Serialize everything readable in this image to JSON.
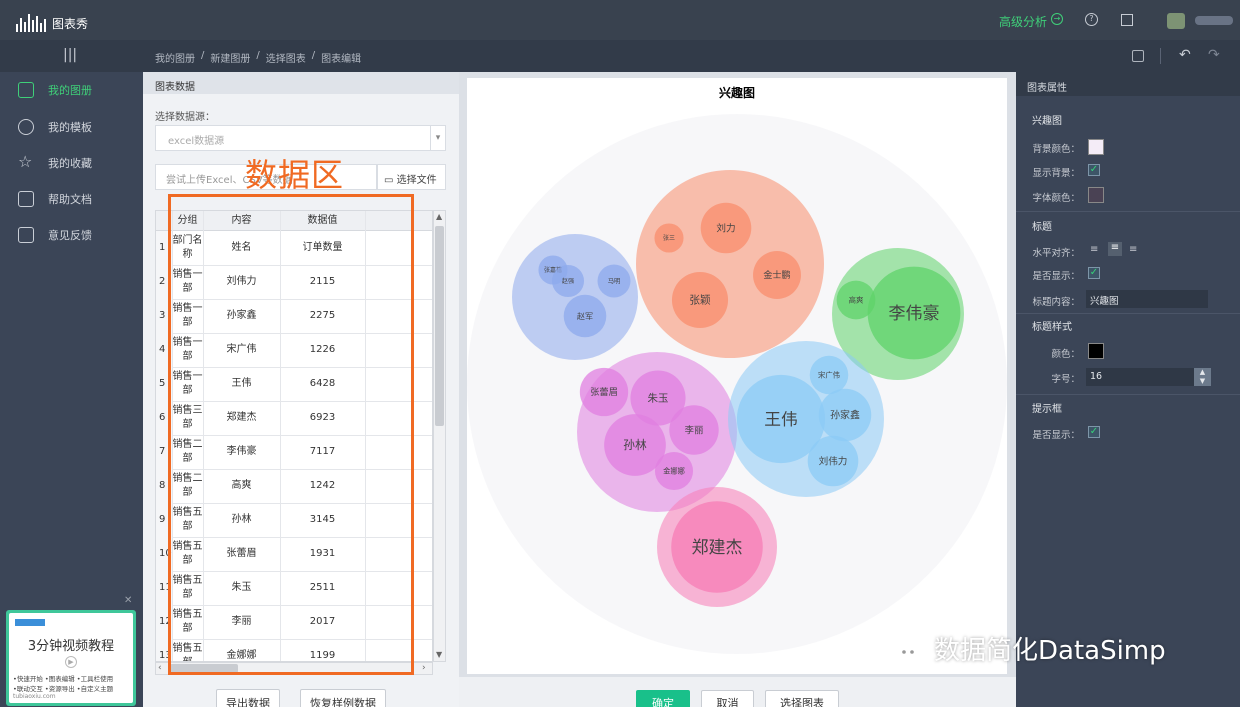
{
  "app": {
    "brand": "图表秀",
    "advanced": "高级分析"
  },
  "breadcrumb": [
    "我的图册",
    "/",
    "新建图册",
    "/",
    "选择图表",
    "/",
    "图表编辑"
  ],
  "sidebar": {
    "items": [
      {
        "label": "我的图册"
      },
      {
        "label": "我的模板"
      },
      {
        "label": "我的收藏"
      },
      {
        "label": "帮助文档"
      },
      {
        "label": "意见反馈"
      }
    ]
  },
  "promo": {
    "title": "3分钟视频教程",
    "lines": [
      "•快速开始 •图表编辑 •工具栏使用",
      "•联动交互 •资源导出 •自定义主题"
    ],
    "url": "tubiaoxiu.com"
  },
  "data_panel": {
    "title": "图表数据",
    "source_label": "选择数据源：",
    "source_value": "excel数据源",
    "upload_placeholder": "尝试上传Excel、CSV等数据",
    "upload_button": "选择文件",
    "export_button": "导出数据",
    "restore_button": "恢复样例数据",
    "annotation": "数据区"
  },
  "table": {
    "headers": [
      "分组",
      "内容",
      "数据值"
    ],
    "rows": [
      {
        "n": "1",
        "g": "部门名称",
        "c": "姓名",
        "v": "订单数量"
      },
      {
        "n": "2",
        "g": "销售一部",
        "c": "刘伟力",
        "v": "2115"
      },
      {
        "n": "3",
        "g": "销售一部",
        "c": "孙家鑫",
        "v": "2275"
      },
      {
        "n": "4",
        "g": "销售一部",
        "c": "宋广伟",
        "v": "1226"
      },
      {
        "n": "5",
        "g": "销售一部",
        "c": "王伟",
        "v": "6428"
      },
      {
        "n": "6",
        "g": "销售三部",
        "c": "郑建杰",
        "v": "6923"
      },
      {
        "n": "7",
        "g": "销售二部",
        "c": "李伟豪",
        "v": "7117"
      },
      {
        "n": "8",
        "g": "销售二部",
        "c": "高爽",
        "v": "1242"
      },
      {
        "n": "9",
        "g": "销售五部",
        "c": "孙林",
        "v": "3145"
      },
      {
        "n": "10",
        "g": "销售五部",
        "c": "张蕾眉",
        "v": "1931"
      },
      {
        "n": "11",
        "g": "销售五部",
        "c": "朱玉",
        "v": "2511"
      },
      {
        "n": "12",
        "g": "销售五部",
        "c": "李丽",
        "v": "2017"
      },
      {
        "n": "13",
        "g": "销售五部",
        "c": "金娜娜",
        "v": "1199"
      }
    ]
  },
  "chart_data": {
    "type": "bubble-pack",
    "title": "兴趣图",
    "groups": [
      {
        "color": "#8eaaec",
        "children": [
          {
            "name": "赵军",
            "value": 1500
          },
          {
            "name": "张嘉禧",
            "value": 700
          },
          {
            "name": "赵强",
            "value": 850
          },
          {
            "name": "马明",
            "value": 900
          }
        ]
      },
      {
        "color": "#f98e6c",
        "children": [
          {
            "name": "刘力",
            "value": 2115
          },
          {
            "name": "张三",
            "value": 700
          },
          {
            "name": "张颖",
            "value": 2600
          },
          {
            "name": "金士鹏",
            "value": 1900
          }
        ]
      },
      {
        "color": "#5fd36a",
        "children": [
          {
            "name": "李伟豪",
            "value": 7117
          },
          {
            "name": "高爽",
            "value": 1242
          }
        ]
      },
      {
        "color": "#e07fe0",
        "children": [
          {
            "name": "张蕾眉",
            "value": 1931
          },
          {
            "name": "朱玉",
            "value": 2511
          },
          {
            "name": "孙林",
            "value": 3145
          },
          {
            "name": "李丽",
            "value": 2017
          },
          {
            "name": "金娜娜",
            "value": 1199
          }
        ]
      },
      {
        "color": "#8ccbf6",
        "children": [
          {
            "name": "王伟",
            "value": 6428
          },
          {
            "name": "宋广伟",
            "value": 1226
          },
          {
            "name": "孙家鑫",
            "value": 2275
          },
          {
            "name": "刘伟力",
            "value": 2115
          }
        ]
      },
      {
        "color": "#f77cb6",
        "children": [
          {
            "name": "郑建杰",
            "value": 6923
          }
        ]
      }
    ]
  },
  "actions": {
    "confirm": "确定",
    "cancel": "取消",
    "choose_chart": "选择图表"
  },
  "properties": {
    "title": "图表属性",
    "section_chart": "兴趣图",
    "bg_color_label": "背景颜色：",
    "bg_color": "#f4ecf7",
    "show_bg_label": "显示背景：",
    "font_color_label": "字体颜色：",
    "font_color": "#4a4254",
    "section_title": "标题",
    "align_label": "水平对齐：",
    "show_label": "是否显示：",
    "content_label": "标题内容：",
    "content_value": "兴趣图",
    "section_style": "标题样式",
    "color_label": "颜色：",
    "title_color": "#000000",
    "size_label": "字号：",
    "size_value": "16",
    "section_tooltip": "提示框",
    "tooltip_show_label": "是否显示："
  },
  "watermark": "数据简化DataSimp"
}
